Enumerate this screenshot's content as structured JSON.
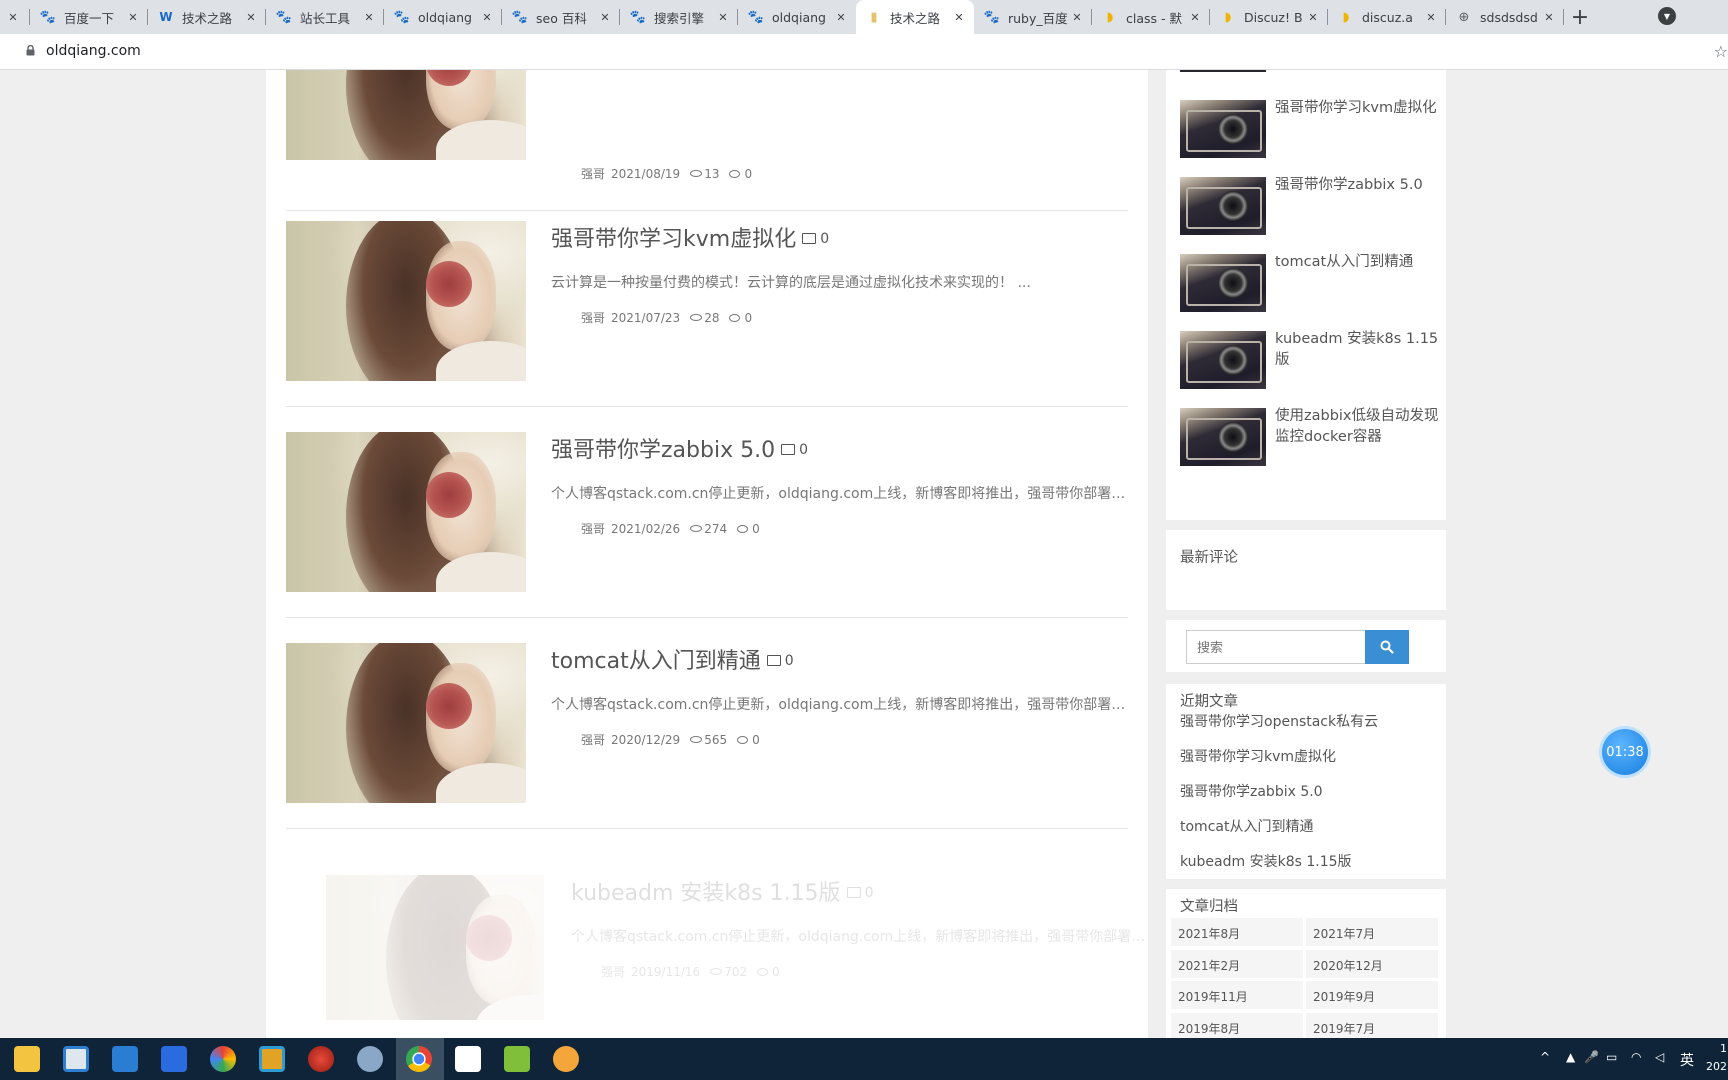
{
  "browser": {
    "tabs": [
      {
        "title": "",
        "icon": "close-icon"
      },
      {
        "title": "百度一下",
        "icon": "baidu-paw-icon"
      },
      {
        "title": "技术之路",
        "icon": "blue-w-icon"
      },
      {
        "title": "站长工具",
        "icon": "baidu-paw-icon"
      },
      {
        "title": "oldqiang",
        "icon": "baidu-paw-icon"
      },
      {
        "title": "seo 百科",
        "icon": "baidu-paw-icon"
      },
      {
        "title": "搜索引擎",
        "icon": "baidu-paw-icon"
      },
      {
        "title": "oldqiang",
        "icon": "baidu-paw-icon"
      },
      {
        "title": "技术之路",
        "icon": "doc-icon"
      },
      {
        "title": "ruby_百度",
        "icon": "baidu-paw-icon"
      },
      {
        "title": "class - 默",
        "icon": "discuz-icon"
      },
      {
        "title": "Discuz! B",
        "icon": "discuz-icon"
      },
      {
        "title": "discuz.a",
        "icon": "discuz-icon"
      },
      {
        "title": "sdsdsdsd",
        "icon": "globe-icon"
      }
    ],
    "active_tab": 8,
    "url": "oldqiang.com"
  },
  "posts": [
    {
      "title": "",
      "excerpt": "",
      "author": "强哥",
      "date": "2021/08/19",
      "views": "13",
      "comments": "0",
      "faded": false
    },
    {
      "title": "强哥带你学习kvm虚拟化",
      "img_count": "0",
      "excerpt": "云计算是一种按量付费的模式！云计算的底层是通过虚拟化技术来实现的！  ...",
      "author": "强哥",
      "date": "2021/07/23",
      "views": "28",
      "comments": "0",
      "faded": false
    },
    {
      "title": "强哥带你学zabbix 5.0",
      "img_count": "0",
      "excerpt": "个人博客qstack.com.cn停止更新，oldqiang.com上线，新博客即将推出，强哥带你部署sp...",
      "author": "强哥",
      "date": "2021/02/26",
      "views": "274",
      "comments": "0",
      "faded": false
    },
    {
      "title": "tomcat从入门到精通",
      "img_count": "0",
      "excerpt": "个人博客qstack.com.cn停止更新，oldqiang.com上线，新博客即将推出，强哥带你部署sp...",
      "author": "强哥",
      "date": "2020/12/29",
      "views": "565",
      "comments": "0",
      "faded": false
    },
    {
      "title": "kubeadm 安装k8s 1.15版",
      "img_count": "0",
      "excerpt": "个人博客qstack.com.cn停止更新，oldqiang.com上线，新博客即将推出，强哥带你部署sp...",
      "author": "强哥",
      "date": "2019/11/16",
      "views": "702",
      "comments": "0",
      "faded": true
    }
  ],
  "sidebar": {
    "hot_posts": [
      "强哥带你学习kvm虚拟化",
      "强哥带你学zabbix 5.0",
      "tomcat从入门到精通",
      "kubeadm 安装k8s 1.15版",
      "使用zabbix低级自动发现监控docker容器"
    ],
    "latest_comments_title": "最新评论",
    "search_placeholder": "搜索",
    "recent_title": "近期文章",
    "recent_posts": [
      "强哥带你学习openstack私有云",
      "强哥带你学习kvm虚拟化",
      "强哥带你学zabbix 5.0",
      "tomcat从入门到精通",
      "kubeadm 安装k8s 1.15版"
    ],
    "archive_title": "文章归档",
    "archives": [
      "2021年8月",
      "2021年7月",
      "2021年2月",
      "2020年12月",
      "2019年11月",
      "2019年9月",
      "2019年8月",
      "2019年7月"
    ]
  },
  "timer": "01:38",
  "taskbar": {
    "apps": [
      "file-explorer-icon",
      "store-icon",
      "mail-icon",
      "feishu-icon",
      "color-wheel-icon",
      "terminal-icon",
      "weibo-icon",
      "paint-icon",
      "chrome-icon",
      "typora-icon",
      "notepad-icon",
      "package-icon"
    ],
    "tray_ime": "英",
    "clock_partial": "1",
    "date_partial": "202"
  }
}
